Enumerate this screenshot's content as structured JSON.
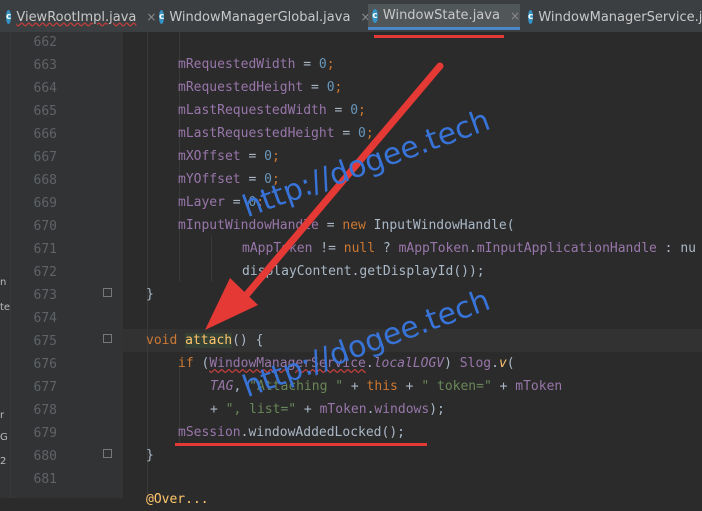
{
  "tabs": [
    {
      "label": "ViewRootImpl.java",
      "active": false
    },
    {
      "label": "WindowManagerGlobal.java",
      "active": false
    },
    {
      "label": "WindowState.java",
      "active": true
    },
    {
      "label": "WindowManagerService.java",
      "active": false
    }
  ],
  "tab_icon_letter": "c",
  "tab_close": "×",
  "line_numbers": [
    "662",
    "663",
    "664",
    "665",
    "666",
    "667",
    "668",
    "669",
    "670",
    "671",
    "672",
    "673",
    "674",
    "675",
    "676",
    "677",
    "678",
    "679",
    "680",
    "681"
  ],
  "code": {
    "l663": {
      "field": "mRequestedWidth",
      "op": " = ",
      "num": "0",
      "end": ";"
    },
    "l664": {
      "field": "mRequestedHeight",
      "op": " = ",
      "num": "0",
      "end": ";"
    },
    "l665": {
      "field": "mLastRequestedWidth",
      "op": " = ",
      "num": "0",
      "end": ";"
    },
    "l666": {
      "field": "mLastRequestedHeight",
      "op": " = ",
      "num": "0",
      "end": ";"
    },
    "l667": {
      "field": "mXOffset",
      "op": " = ",
      "num": "0",
      "end": ";"
    },
    "l668": {
      "field": "mYOffset",
      "op": " = ",
      "num": "0",
      "end": ";"
    },
    "l669": {
      "field": "mLayer",
      "op": " = ",
      "num": "0",
      "end": ";"
    },
    "l670": {
      "field": "mInputWindowHandle",
      "op": " = ",
      "kw": "new",
      "rest": " InputWindowHandle("
    },
    "l671": {
      "field": "mAppToken",
      "mid": " != ",
      "kw": "null",
      "q": " ? ",
      "field2": "mAppToken",
      "dot": ".",
      "field3": "mInputApplicationHandle",
      "rest": " : nu"
    },
    "l672": {
      "text1": "displayContent.getDisplayId());"
    },
    "l673": {
      "text": "}"
    },
    "l675": {
      "kw": "void",
      "sp": " ",
      "fn": "attach",
      "rest": "() {"
    },
    "l676": {
      "kw": "if",
      "sp": " (",
      "cls": "WindowManagerService",
      "dot": ".",
      "static": "localLOGV",
      "close": ") ",
      "slog": "Slog",
      "dot2": ".",
      "v": "v",
      "rest": "("
    },
    "l677": {
      "tag": "TAG",
      "sep": ", ",
      "str1": "\"Attaching \"",
      "plus1": " + ",
      "kwthis": "this",
      "plus2": " + ",
      "str2": "\" token=\"",
      "plus3": " + ",
      "tok": "mToken"
    },
    "l678": {
      "plus": "+ ",
      "str": "\", list=\"",
      "plus2": " + ",
      "tok": "mToken",
      "dot": ".",
      "win": "windows",
      "rest": ");"
    },
    "l679": {
      "sess": "mSession",
      "dot": ".",
      "call": "windowAddedLocked",
      "rest": "();"
    },
    "l680": {
      "text": "}"
    },
    "l682_partial": {
      "text": "@Over..."
    }
  },
  "watermarks": [
    "http://dogee.tech",
    "http://dogee.tech"
  ],
  "left_strip_chars": [
    "n",
    "te",
    "r",
    "G",
    "2"
  ],
  "colors": {
    "accent_arrow": "#e53935",
    "watermark": "#3874d8",
    "active_tab": "#4a88c7"
  }
}
